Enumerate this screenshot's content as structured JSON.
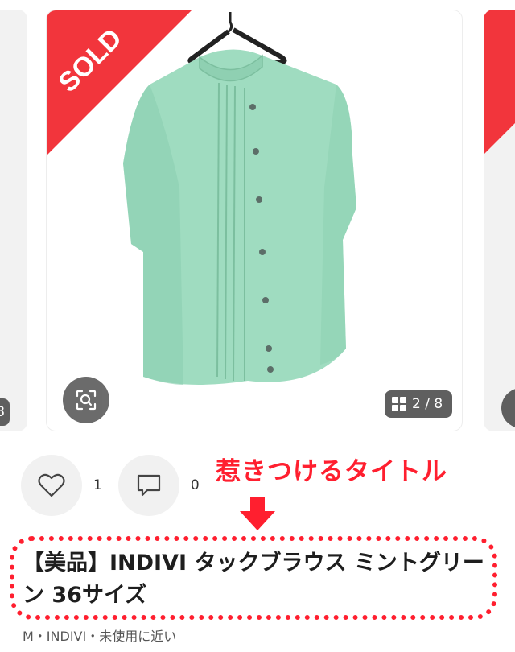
{
  "carousel": {
    "sold_label": "SOLD",
    "counter": "2 / 8",
    "left_counter": "8"
  },
  "actions": {
    "likes_count": "1",
    "comments_count": "0"
  },
  "annotation": {
    "catchphrase": "惹きつけるタイトル"
  },
  "product": {
    "title": "【美品】INDIVI タックブラウス ミントグリーン 36サイズ",
    "subtitle": "M・INDIVI・未使用に近い"
  },
  "colors": {
    "sold_red": "#f2353c",
    "accent_red": "#ff1f2f",
    "blouse_mint": "#9fdcc0"
  }
}
